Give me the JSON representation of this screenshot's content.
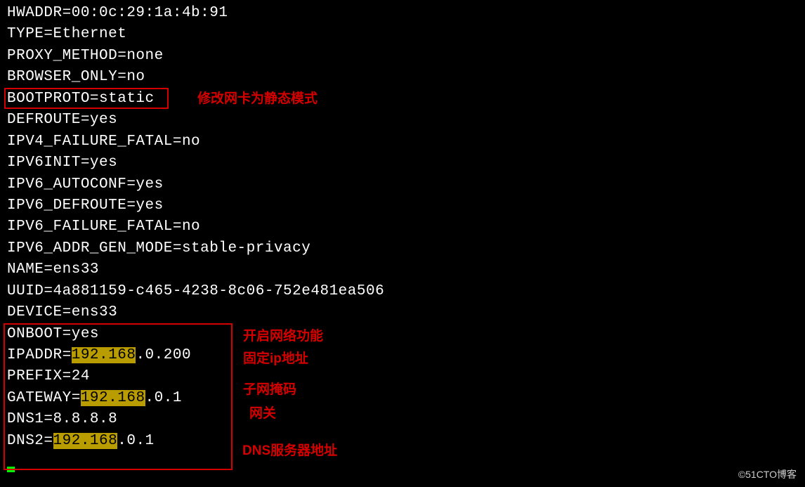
{
  "lines": {
    "hwaddr": "HWADDR=00:0c:29:1a:4b:91",
    "type": "TYPE=Ethernet",
    "proxy_method": "PROXY_METHOD=none",
    "browser_only": "BROWSER_ONLY=no",
    "bootproto": "BOOTPROTO=static",
    "defroute": "DEFROUTE=yes",
    "ipv4_failure_fatal": "IPV4_FAILURE_FATAL=no",
    "ipv6init": "IPV6INIT=yes",
    "ipv6_autoconf": "IPV6_AUTOCONF=yes",
    "ipv6_defroute": "IPV6_DEFROUTE=yes",
    "ipv6_failure_fatal": "IPV6_FAILURE_FATAL=no",
    "ipv6_addr_gen_mode": "IPV6_ADDR_GEN_MODE=stable-privacy",
    "name": "NAME=ens33",
    "uuid": "UUID=4a881159-c465-4238-8c06-752e481ea506",
    "device": "DEVICE=ens33",
    "onboot": "ONBOOT=yes",
    "ipaddr_prefix": "IPADDR=",
    "ipaddr_hl": "192.168",
    "ipaddr_suffix": ".0.200",
    "prefix": "PREFIX=24",
    "gateway_prefix": "GATEWAY=",
    "gateway_hl": "192.168",
    "gateway_suffix": ".0.1",
    "dns1": "DNS1=8.8.8.8",
    "dns2_prefix": "DNS2=",
    "dns2_hl": "192.168",
    "dns2_suffix": ".0.1"
  },
  "annotations": {
    "bootproto": "修改网卡为静态模式",
    "onboot": "开启网络功能",
    "ipaddr": "固定ip地址",
    "prefix": "子网掩码",
    "gateway": "网关",
    "dns": "DNS服务器地址"
  },
  "watermark": "©51CTO博客"
}
